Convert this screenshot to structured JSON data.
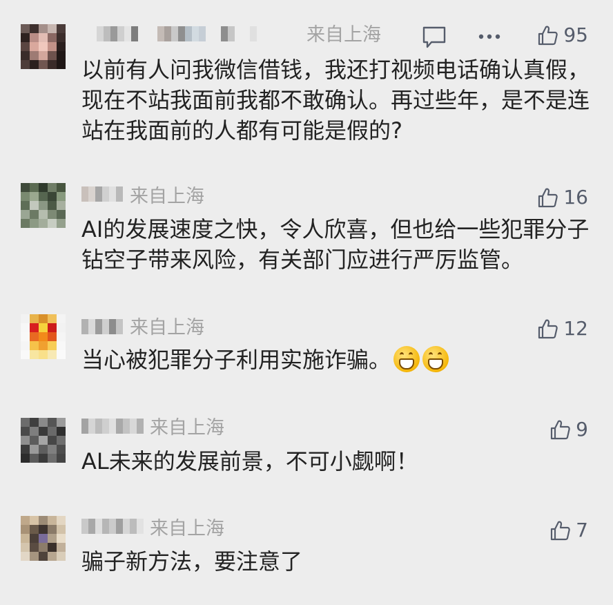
{
  "comments": [
    {
      "location": "来自上海",
      "text": "以前有人问我微信借钱，我还打视频电话确认真假，现在不站我面前我都不敢确认。再过些年，是不是连站在我面前的人都有可能是假的?",
      "likes": "95",
      "icons": [
        "reply-icon",
        "more-icon",
        "thumb-up-icon"
      ]
    },
    {
      "location": "来自上海",
      "text": "AI的发展速度之快，令人欣喜，但也给一些犯罪分子钻空子带来风险，有关部门应进行严厉监管。",
      "likes": "16",
      "icons": [
        "thumb-up-icon"
      ]
    },
    {
      "location": "来自上海",
      "text": "当心被犯罪分子利用实施诈骗。",
      "emoji": [
        "grin-emoji",
        "grin-emoji"
      ],
      "likes": "12",
      "icons": [
        "thumb-up-icon"
      ]
    },
    {
      "location": "来自上海",
      "text": "AL未来的发展前景，不可小觑啊！",
      "likes": "9",
      "icons": [
        "thumb-up-icon"
      ]
    },
    {
      "location": "来自上海",
      "text": "骗子新方法，要注意了",
      "likes": "7",
      "icons": [
        "thumb-up-icon"
      ]
    }
  ],
  "colors": {
    "background": "#ededed",
    "text": "#222222",
    "meta": "#a3a3a3",
    "icon": "#555c6b"
  }
}
